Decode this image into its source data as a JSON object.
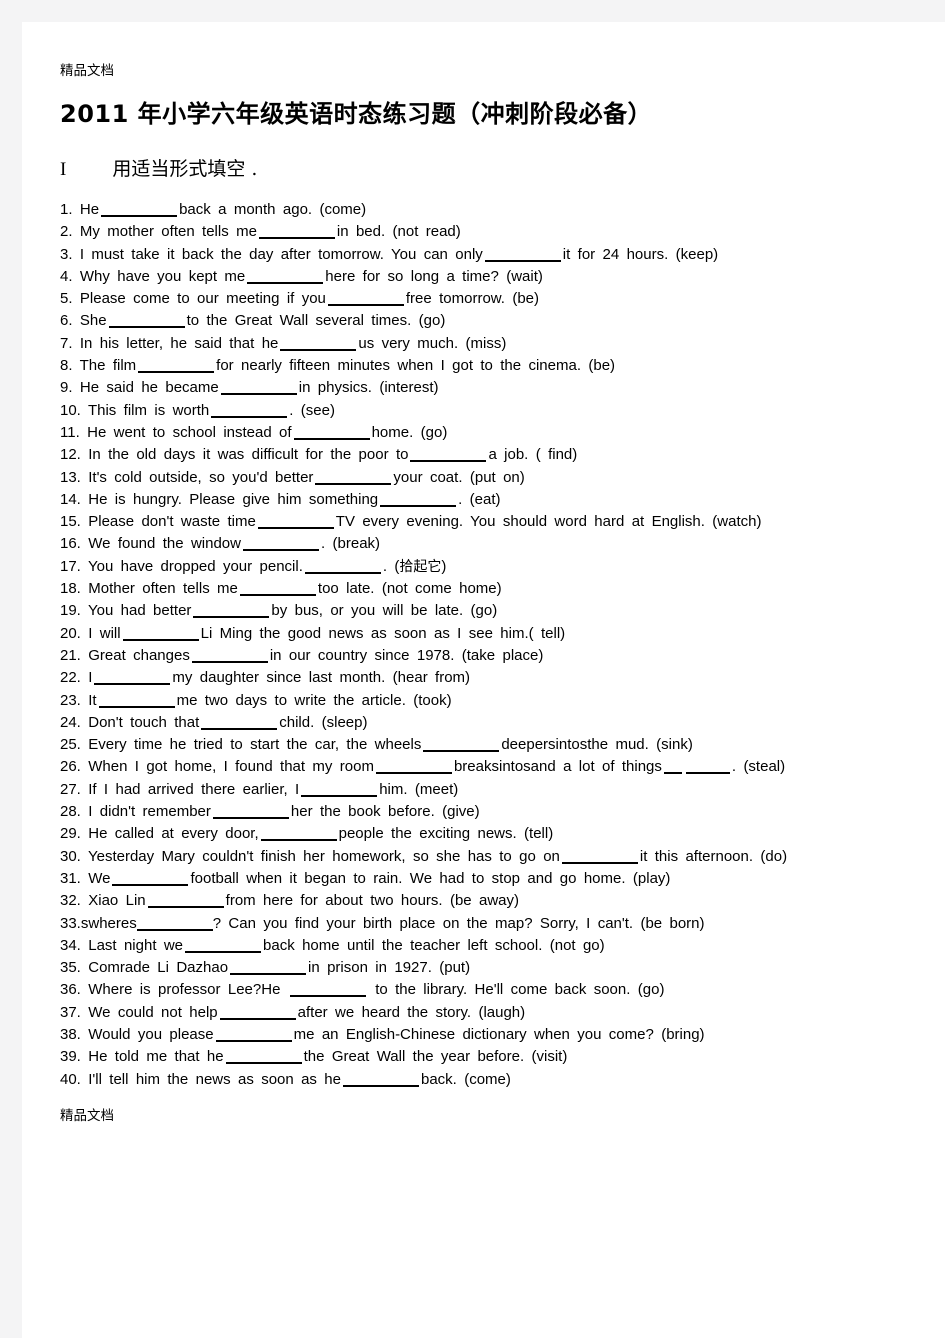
{
  "document": {
    "watermark_top": "精品文档",
    "watermark_bottom": "精品文档",
    "title": "2011 年小学六年级英语时态练习题（冲刺阶段必备）",
    "section": {
      "numeral": "I",
      "label": "用适当形式填空 ."
    }
  },
  "questions": [
    {
      "num": "1.",
      "pre": "He",
      "post": "back a month ago.  (come)"
    },
    {
      "num": "2.",
      "pre": "My mother often tells me",
      "post": "in bed.  (not read)"
    },
    {
      "num": "3.",
      "pre": "I must take it back the day after tomorrow.  You can only",
      "post": "it for 24 hours.  (keep)"
    },
    {
      "num": "4.",
      "pre": "Why have you kept me",
      "post": "here for so long a time?  (wait)"
    },
    {
      "num": "5.",
      "pre": "Please come to our meeting if you",
      "post": "free tomorrow.  (be)"
    },
    {
      "num": "6.",
      "pre": "She",
      "post": "to the Great Wall several times.  (go)"
    },
    {
      "num": "7.",
      "pre": "In his letter, he said that he",
      "post": "us very much.  (miss)"
    },
    {
      "num": "8.",
      "pre": "The film",
      "post": "for nearly fifteen minutes when I got to the cinema.  (be)"
    },
    {
      "num": "9.",
      "pre": "He said he became",
      "post": "in physics.  (interest)"
    },
    {
      "num": "10.",
      "pre": "This film is worth",
      "post": ".   (see)"
    },
    {
      "num": "11.",
      "pre": "He went to school instead of",
      "post": "home.  (go)"
    },
    {
      "num": "12.",
      "pre": "In the old days it was difficult for the poor to",
      "post": "a job.  ( find)"
    },
    {
      "num": "13.",
      "pre": "It's cold outside, so you'd better",
      "post": "your coat.  (put on)"
    },
    {
      "num": "14.",
      "pre": "He is hungry. Please give him something",
      "post": ".   (eat)"
    },
    {
      "num": "15.",
      "pre": "Please don't waste time",
      "post": "TV every evening.  You should word hard at English.  (watch)"
    },
    {
      "num": "16.",
      "pre": "We found the window",
      "post": ".   (break)"
    },
    {
      "num": "17.",
      "pre": "You have dropped your pencil.",
      "post": ".   (",
      "cn": "拾起它",
      "post2": ")"
    },
    {
      "num": "18.",
      "pre": "Mother often tells me",
      "post": "too late.  (not come home)"
    },
    {
      "num": "19.",
      "pre": "You had better",
      "post": "by bus, or you will be late.  (go)"
    },
    {
      "num": "20.",
      "pre": "I will",
      "post": "Li Ming the good news as soon as I see him.(  tell)"
    },
    {
      "num": "21.",
      "pre": "Great changes",
      "post": "in our country since 1978.  (take place)"
    },
    {
      "num": "22.",
      "pre": "I",
      "post": "my daughter since last month.  (hear from)"
    },
    {
      "num": "23.",
      "pre": "It",
      "post": "me two days to write the article.  (took)"
    },
    {
      "num": "24.",
      "pre": "Don't touch that",
      "post": "child.  (sleep)"
    },
    {
      "num": "25.",
      "pre": "Every time he tried to start the car, the wheels",
      "post": "deepersintosthe  mud.  (sink)"
    },
    {
      "num": "26.",
      "pre": "When I got home, I found that my room",
      "post": "breaksintosand  a lot of things",
      "trailing_blank": true,
      "post3": ".   (steal)"
    },
    {
      "num": "27.",
      "pre": "If I had arrived there earlier, I",
      "post": "him.  (meet)"
    },
    {
      "num": "28.",
      "pre": "I didn't remember",
      "post": "her the book before.  (give)"
    },
    {
      "num": "29.",
      "pre": "He called at every door,",
      "post": "people the exciting news.  (tell)"
    },
    {
      "num": "30.",
      "pre": "Yesterday Mary couldn't finish her homework, so she has to go on",
      "post": "it this afternoon.   (do)"
    },
    {
      "num": "31.",
      "pre": "We",
      "post": "football when it began to rain. We had to stop and go home.  (play)"
    },
    {
      "num": "32.",
      "pre": "Xiao Lin",
      "post": "from here for about two hours.  (be away)"
    },
    {
      "num": "33.",
      "pre": "swheres",
      "post": "?   Can you find your birth place on the map? Sorry, I can't.  (be born)",
      "inline": true
    },
    {
      "num": "34.",
      "pre": "Last night we",
      "post": "back home until the teacher left school.  (not go)"
    },
    {
      "num": "35.",
      "pre": "Comrade Li Dazhao",
      "post": "in prison in 1927.  (put)"
    },
    {
      "num": "36.",
      "pre": "Where is professor Lee?",
      "pre2": "He",
      "post": "to the library. He'll come back soon.  (go)"
    },
    {
      "num": "37.",
      "pre": "We could not help",
      "post": "after we heard the story.  (laugh)"
    },
    {
      "num": "38.",
      "pre": "Would you please",
      "post": "me an English-Chinese dictionary when you come?  (bring)"
    },
    {
      "num": "39.",
      "pre": "He told me that he",
      "post": "the Great Wall the year before.  (visit)"
    },
    {
      "num": "40.",
      "pre": "I'll tell him the news as soon as he",
      "post": "back.  (come)"
    }
  ]
}
